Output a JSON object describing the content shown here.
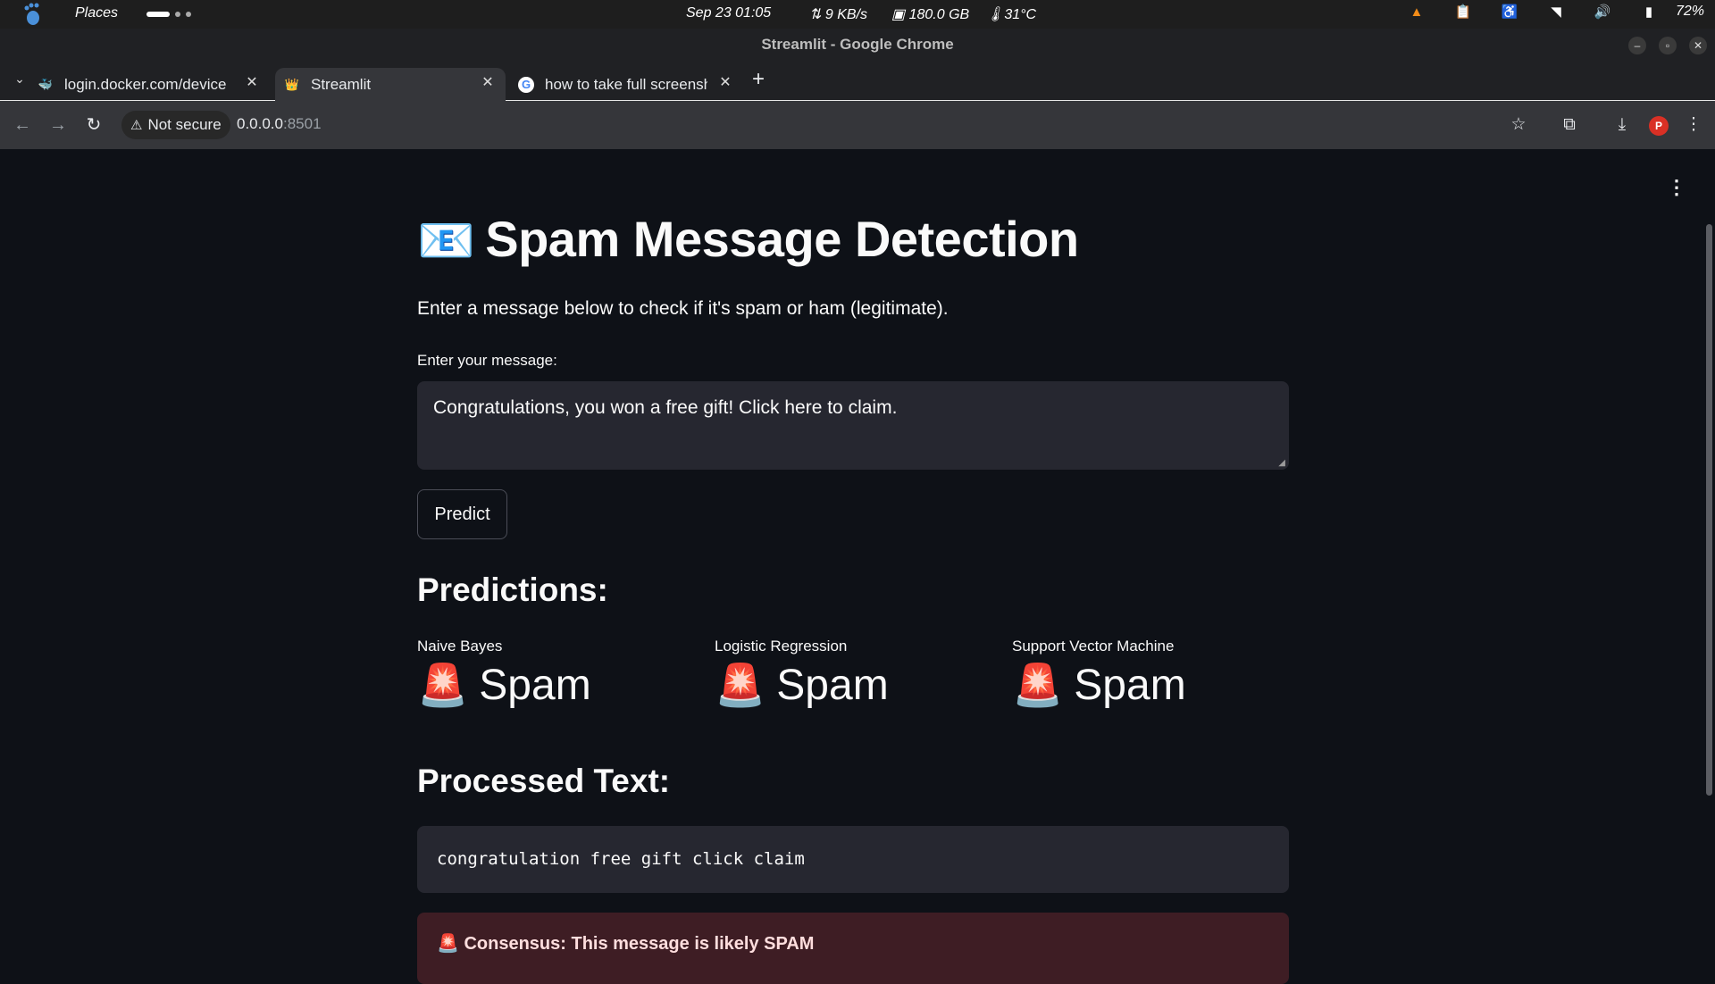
{
  "system_bar": {
    "places": "Places",
    "clock": "Sep 23  01:05",
    "net": "9 KB/s",
    "disk": "180.0 GB",
    "temp": "31°C",
    "battery": "72%"
  },
  "window": {
    "title": "Streamlit - Google Chrome"
  },
  "tabs": [
    {
      "title": "login.docker.com/device",
      "icon": "docker-icon",
      "active": false
    },
    {
      "title": "Streamlit",
      "icon": "streamlit-icon",
      "active": true
    },
    {
      "title": "how to take full screenshot",
      "icon": "google-icon",
      "active": false
    }
  ],
  "address_bar": {
    "security": "Not secure",
    "host": "0.0.0.0",
    "port": ":8501"
  },
  "app": {
    "title_emoji": "📧",
    "title": "Spam Message Detection",
    "subtitle": "Enter a message below to check if it's spam or ham (legitimate).",
    "input_label": "Enter your message:",
    "input_value": "Congratulations, you won a free gift! Click here to claim.",
    "predict_label": "Predict",
    "predictions_heading": "Predictions:",
    "predictions": [
      {
        "model": "Naive Bayes",
        "emoji": "🚨",
        "result": "Spam"
      },
      {
        "model": "Logistic Regression",
        "emoji": "🚨",
        "result": "Spam"
      },
      {
        "model": "Support Vector Machine",
        "emoji": "🚨",
        "result": "Spam"
      }
    ],
    "processed_heading": "Processed Text:",
    "processed_text": "congratulation free gift click claim",
    "consensus": "🚨 Consensus: This message is likely SPAM"
  },
  "colors": {
    "page_bg": "#0e1117",
    "input_bg": "#262730",
    "alert_bg": "#3e1d24",
    "text": "#fafafa"
  }
}
